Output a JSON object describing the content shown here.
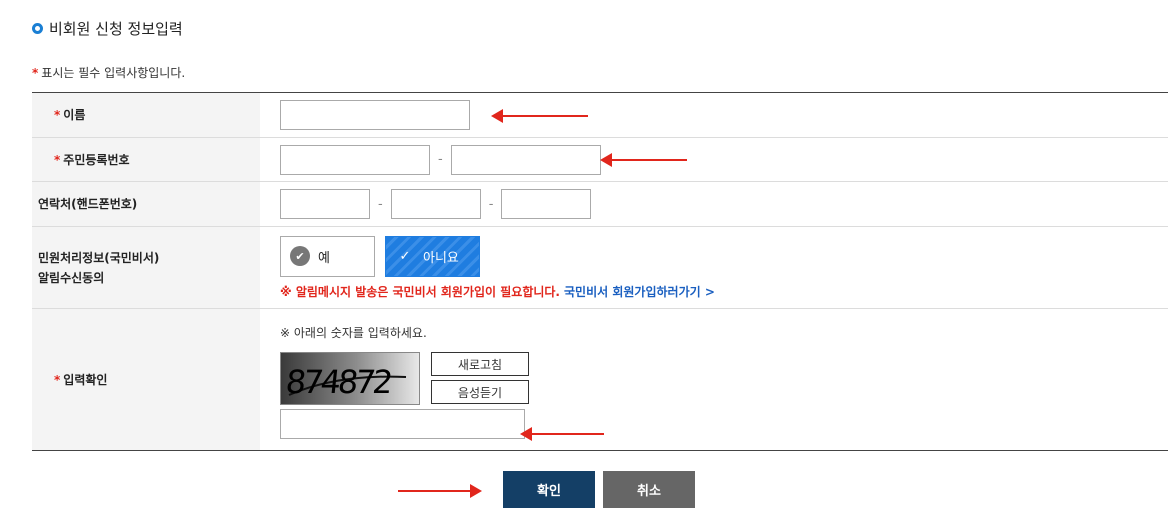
{
  "section": {
    "title": "비회원 신청 정보입력"
  },
  "required_note": {
    "star": "*",
    "text": "표시는 필수 입력사항입니다."
  },
  "fields": {
    "name": {
      "label": "이름",
      "value": ""
    },
    "rrn": {
      "label": "주민등록번호",
      "part1": "",
      "part2": "",
      "separator": "-"
    },
    "phone": {
      "label": "연락처(핸드폰번호)",
      "p1": "",
      "p2": "",
      "p3": "",
      "separator": "-"
    },
    "consent": {
      "label_line1": "민원처리정보(국민비서)",
      "label_line2": "알림수신동의",
      "yes": "예",
      "no": "아니요",
      "selected": "no",
      "notice": "※ 알림메시지 발송은 국민비서 회원가입이 필요합니다.",
      "link": "국민비서 회원가입하러가기 >"
    },
    "captcha": {
      "label": "입력확인",
      "hint": "※ 아래의 숫자를 입력하세요.",
      "code": "874872",
      "refresh": "새로고침",
      "audio": "음성듣기",
      "value": ""
    }
  },
  "actions": {
    "confirm": "확인",
    "cancel": "취소"
  },
  "colors": {
    "accent": "#1a7fd4",
    "required": "#e1261c",
    "primary_button": "#143f66",
    "secondary_button": "#666666",
    "link": "#1a5fc0"
  }
}
